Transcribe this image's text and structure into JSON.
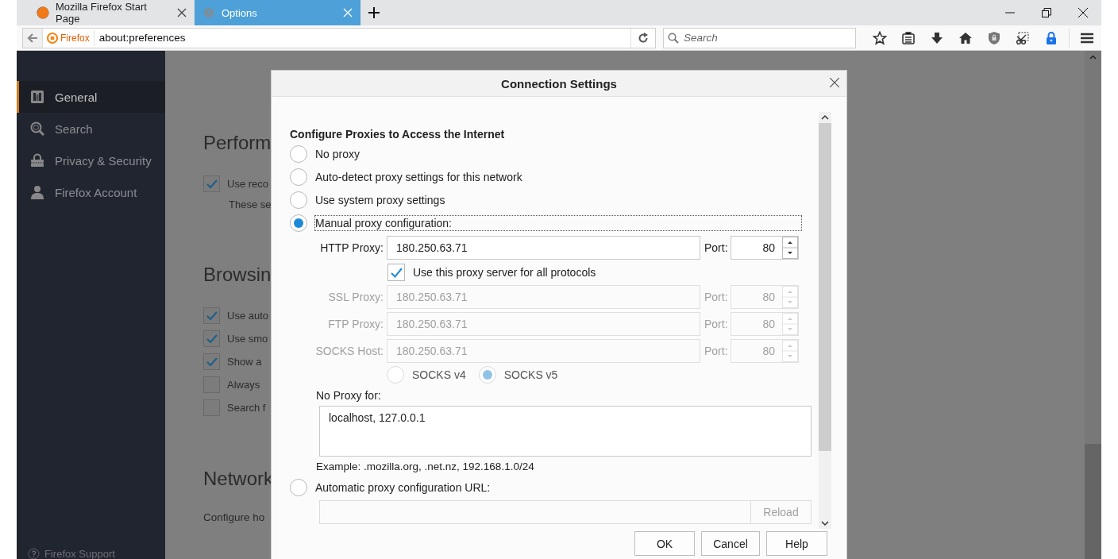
{
  "browser": {
    "tabs": [
      {
        "title": "Mozilla Firefox Start Page",
        "selected": false
      },
      {
        "title": "Options",
        "selected": true
      }
    ],
    "identity": "Firefox",
    "url": "about:preferences",
    "search": {
      "placeholder": "Search"
    }
  },
  "sidebar": {
    "items": [
      {
        "label": "General",
        "selected": true
      },
      {
        "label": "Search",
        "selected": false
      },
      {
        "label": "Privacy & Security",
        "selected": false
      },
      {
        "label": "Firefox Account",
        "selected": false
      }
    ],
    "support_link": "Firefox Support"
  },
  "page": {
    "sections": [
      {
        "heading": "Perform",
        "items": [
          {
            "kind": "checkbox",
            "label": "Use reco",
            "checked": true
          },
          {
            "kind": "note",
            "label": "These se"
          }
        ]
      },
      {
        "heading": "Browsin",
        "items": [
          {
            "kind": "checkbox",
            "label": "Use auto",
            "checked": true
          },
          {
            "kind": "checkbox",
            "label": "Use smo",
            "checked": true
          },
          {
            "kind": "checkbox",
            "label": "Show a",
            "checked": true
          },
          {
            "kind": "checkbox",
            "label": "Always",
            "checked": false
          },
          {
            "kind": "checkbox",
            "label": "Search f",
            "checked": false
          }
        ]
      },
      {
        "heading": "Network",
        "items": [
          {
            "kind": "note",
            "label": "Configure ho"
          }
        ]
      }
    ]
  },
  "dialog": {
    "title": "Connection Settings",
    "heading": "Configure Proxies to Access the Internet",
    "proxy_modes": [
      {
        "label": "No proxy",
        "selected": false
      },
      {
        "label": "Auto-detect proxy settings for this network",
        "selected": false
      },
      {
        "label": "Use system proxy settings",
        "selected": false
      },
      {
        "label": "Manual proxy configuration:",
        "selected": true
      }
    ],
    "proxies": [
      {
        "label": "HTTP Proxy:",
        "value": "180.250.63.71",
        "port_label": "Port:",
        "port": "80",
        "disabled": false
      },
      {
        "label": "SSL Proxy:",
        "value": "180.250.63.71",
        "port_label": "Port:",
        "port": "80",
        "disabled": true
      },
      {
        "label": "FTP Proxy:",
        "value": "180.250.63.71",
        "port_label": "Port:",
        "port": "80",
        "disabled": true
      },
      {
        "label": "SOCKS Host:",
        "value": "180.250.63.71",
        "port_label": "Port:",
        "port": "80",
        "disabled": true
      }
    ],
    "share_all": {
      "label": "Use this proxy server for all protocols",
      "checked": true
    },
    "socks_versions": [
      {
        "label": "SOCKS v4",
        "selected": false
      },
      {
        "label": "SOCKS v5",
        "selected": true
      }
    ],
    "no_proxy": {
      "label": "No Proxy for:",
      "value": "localhost, 127.0.0.1"
    },
    "example": "Example: .mozilla.org, .net.nz, 192.168.1.0/24",
    "auto_config": {
      "label": "Automatic proxy configuration URL:",
      "selected": false,
      "reload": "Reload"
    },
    "buttons": [
      "OK",
      "Cancel",
      "Help"
    ]
  }
}
